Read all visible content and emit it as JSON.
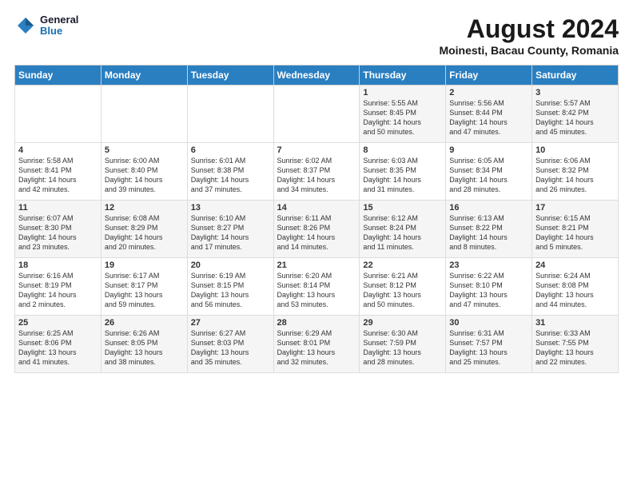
{
  "header": {
    "logo_general": "General",
    "logo_blue": "Blue",
    "main_title": "August 2024",
    "subtitle": "Moinesti, Bacau County, Romania"
  },
  "calendar": {
    "headers": [
      "Sunday",
      "Monday",
      "Tuesday",
      "Wednesday",
      "Thursday",
      "Friday",
      "Saturday"
    ],
    "rows": [
      [
        {
          "day": "",
          "info": ""
        },
        {
          "day": "",
          "info": ""
        },
        {
          "day": "",
          "info": ""
        },
        {
          "day": "",
          "info": ""
        },
        {
          "day": "1",
          "info": "Sunrise: 5:55 AM\nSunset: 8:45 PM\nDaylight: 14 hours\nand 50 minutes."
        },
        {
          "day": "2",
          "info": "Sunrise: 5:56 AM\nSunset: 8:44 PM\nDaylight: 14 hours\nand 47 minutes."
        },
        {
          "day": "3",
          "info": "Sunrise: 5:57 AM\nSunset: 8:42 PM\nDaylight: 14 hours\nand 45 minutes."
        }
      ],
      [
        {
          "day": "4",
          "info": "Sunrise: 5:58 AM\nSunset: 8:41 PM\nDaylight: 14 hours\nand 42 minutes."
        },
        {
          "day": "5",
          "info": "Sunrise: 6:00 AM\nSunset: 8:40 PM\nDaylight: 14 hours\nand 39 minutes."
        },
        {
          "day": "6",
          "info": "Sunrise: 6:01 AM\nSunset: 8:38 PM\nDaylight: 14 hours\nand 37 minutes."
        },
        {
          "day": "7",
          "info": "Sunrise: 6:02 AM\nSunset: 8:37 PM\nDaylight: 14 hours\nand 34 minutes."
        },
        {
          "day": "8",
          "info": "Sunrise: 6:03 AM\nSunset: 8:35 PM\nDaylight: 14 hours\nand 31 minutes."
        },
        {
          "day": "9",
          "info": "Sunrise: 6:05 AM\nSunset: 8:34 PM\nDaylight: 14 hours\nand 28 minutes."
        },
        {
          "day": "10",
          "info": "Sunrise: 6:06 AM\nSunset: 8:32 PM\nDaylight: 14 hours\nand 26 minutes."
        }
      ],
      [
        {
          "day": "11",
          "info": "Sunrise: 6:07 AM\nSunset: 8:30 PM\nDaylight: 14 hours\nand 23 minutes."
        },
        {
          "day": "12",
          "info": "Sunrise: 6:08 AM\nSunset: 8:29 PM\nDaylight: 14 hours\nand 20 minutes."
        },
        {
          "day": "13",
          "info": "Sunrise: 6:10 AM\nSunset: 8:27 PM\nDaylight: 14 hours\nand 17 minutes."
        },
        {
          "day": "14",
          "info": "Sunrise: 6:11 AM\nSunset: 8:26 PM\nDaylight: 14 hours\nand 14 minutes."
        },
        {
          "day": "15",
          "info": "Sunrise: 6:12 AM\nSunset: 8:24 PM\nDaylight: 14 hours\nand 11 minutes."
        },
        {
          "day": "16",
          "info": "Sunrise: 6:13 AM\nSunset: 8:22 PM\nDaylight: 14 hours\nand 8 minutes."
        },
        {
          "day": "17",
          "info": "Sunrise: 6:15 AM\nSunset: 8:21 PM\nDaylight: 14 hours\nand 5 minutes."
        }
      ],
      [
        {
          "day": "18",
          "info": "Sunrise: 6:16 AM\nSunset: 8:19 PM\nDaylight: 14 hours\nand 2 minutes."
        },
        {
          "day": "19",
          "info": "Sunrise: 6:17 AM\nSunset: 8:17 PM\nDaylight: 13 hours\nand 59 minutes."
        },
        {
          "day": "20",
          "info": "Sunrise: 6:19 AM\nSunset: 8:15 PM\nDaylight: 13 hours\nand 56 minutes."
        },
        {
          "day": "21",
          "info": "Sunrise: 6:20 AM\nSunset: 8:14 PM\nDaylight: 13 hours\nand 53 minutes."
        },
        {
          "day": "22",
          "info": "Sunrise: 6:21 AM\nSunset: 8:12 PM\nDaylight: 13 hours\nand 50 minutes."
        },
        {
          "day": "23",
          "info": "Sunrise: 6:22 AM\nSunset: 8:10 PM\nDaylight: 13 hours\nand 47 minutes."
        },
        {
          "day": "24",
          "info": "Sunrise: 6:24 AM\nSunset: 8:08 PM\nDaylight: 13 hours\nand 44 minutes."
        }
      ],
      [
        {
          "day": "25",
          "info": "Sunrise: 6:25 AM\nSunset: 8:06 PM\nDaylight: 13 hours\nand 41 minutes."
        },
        {
          "day": "26",
          "info": "Sunrise: 6:26 AM\nSunset: 8:05 PM\nDaylight: 13 hours\nand 38 minutes."
        },
        {
          "day": "27",
          "info": "Sunrise: 6:27 AM\nSunset: 8:03 PM\nDaylight: 13 hours\nand 35 minutes."
        },
        {
          "day": "28",
          "info": "Sunrise: 6:29 AM\nSunset: 8:01 PM\nDaylight: 13 hours\nand 32 minutes."
        },
        {
          "day": "29",
          "info": "Sunrise: 6:30 AM\nSunset: 7:59 PM\nDaylight: 13 hours\nand 28 minutes."
        },
        {
          "day": "30",
          "info": "Sunrise: 6:31 AM\nSunset: 7:57 PM\nDaylight: 13 hours\nand 25 minutes."
        },
        {
          "day": "31",
          "info": "Sunrise: 6:33 AM\nSunset: 7:55 PM\nDaylight: 13 hours\nand 22 minutes."
        }
      ]
    ]
  }
}
